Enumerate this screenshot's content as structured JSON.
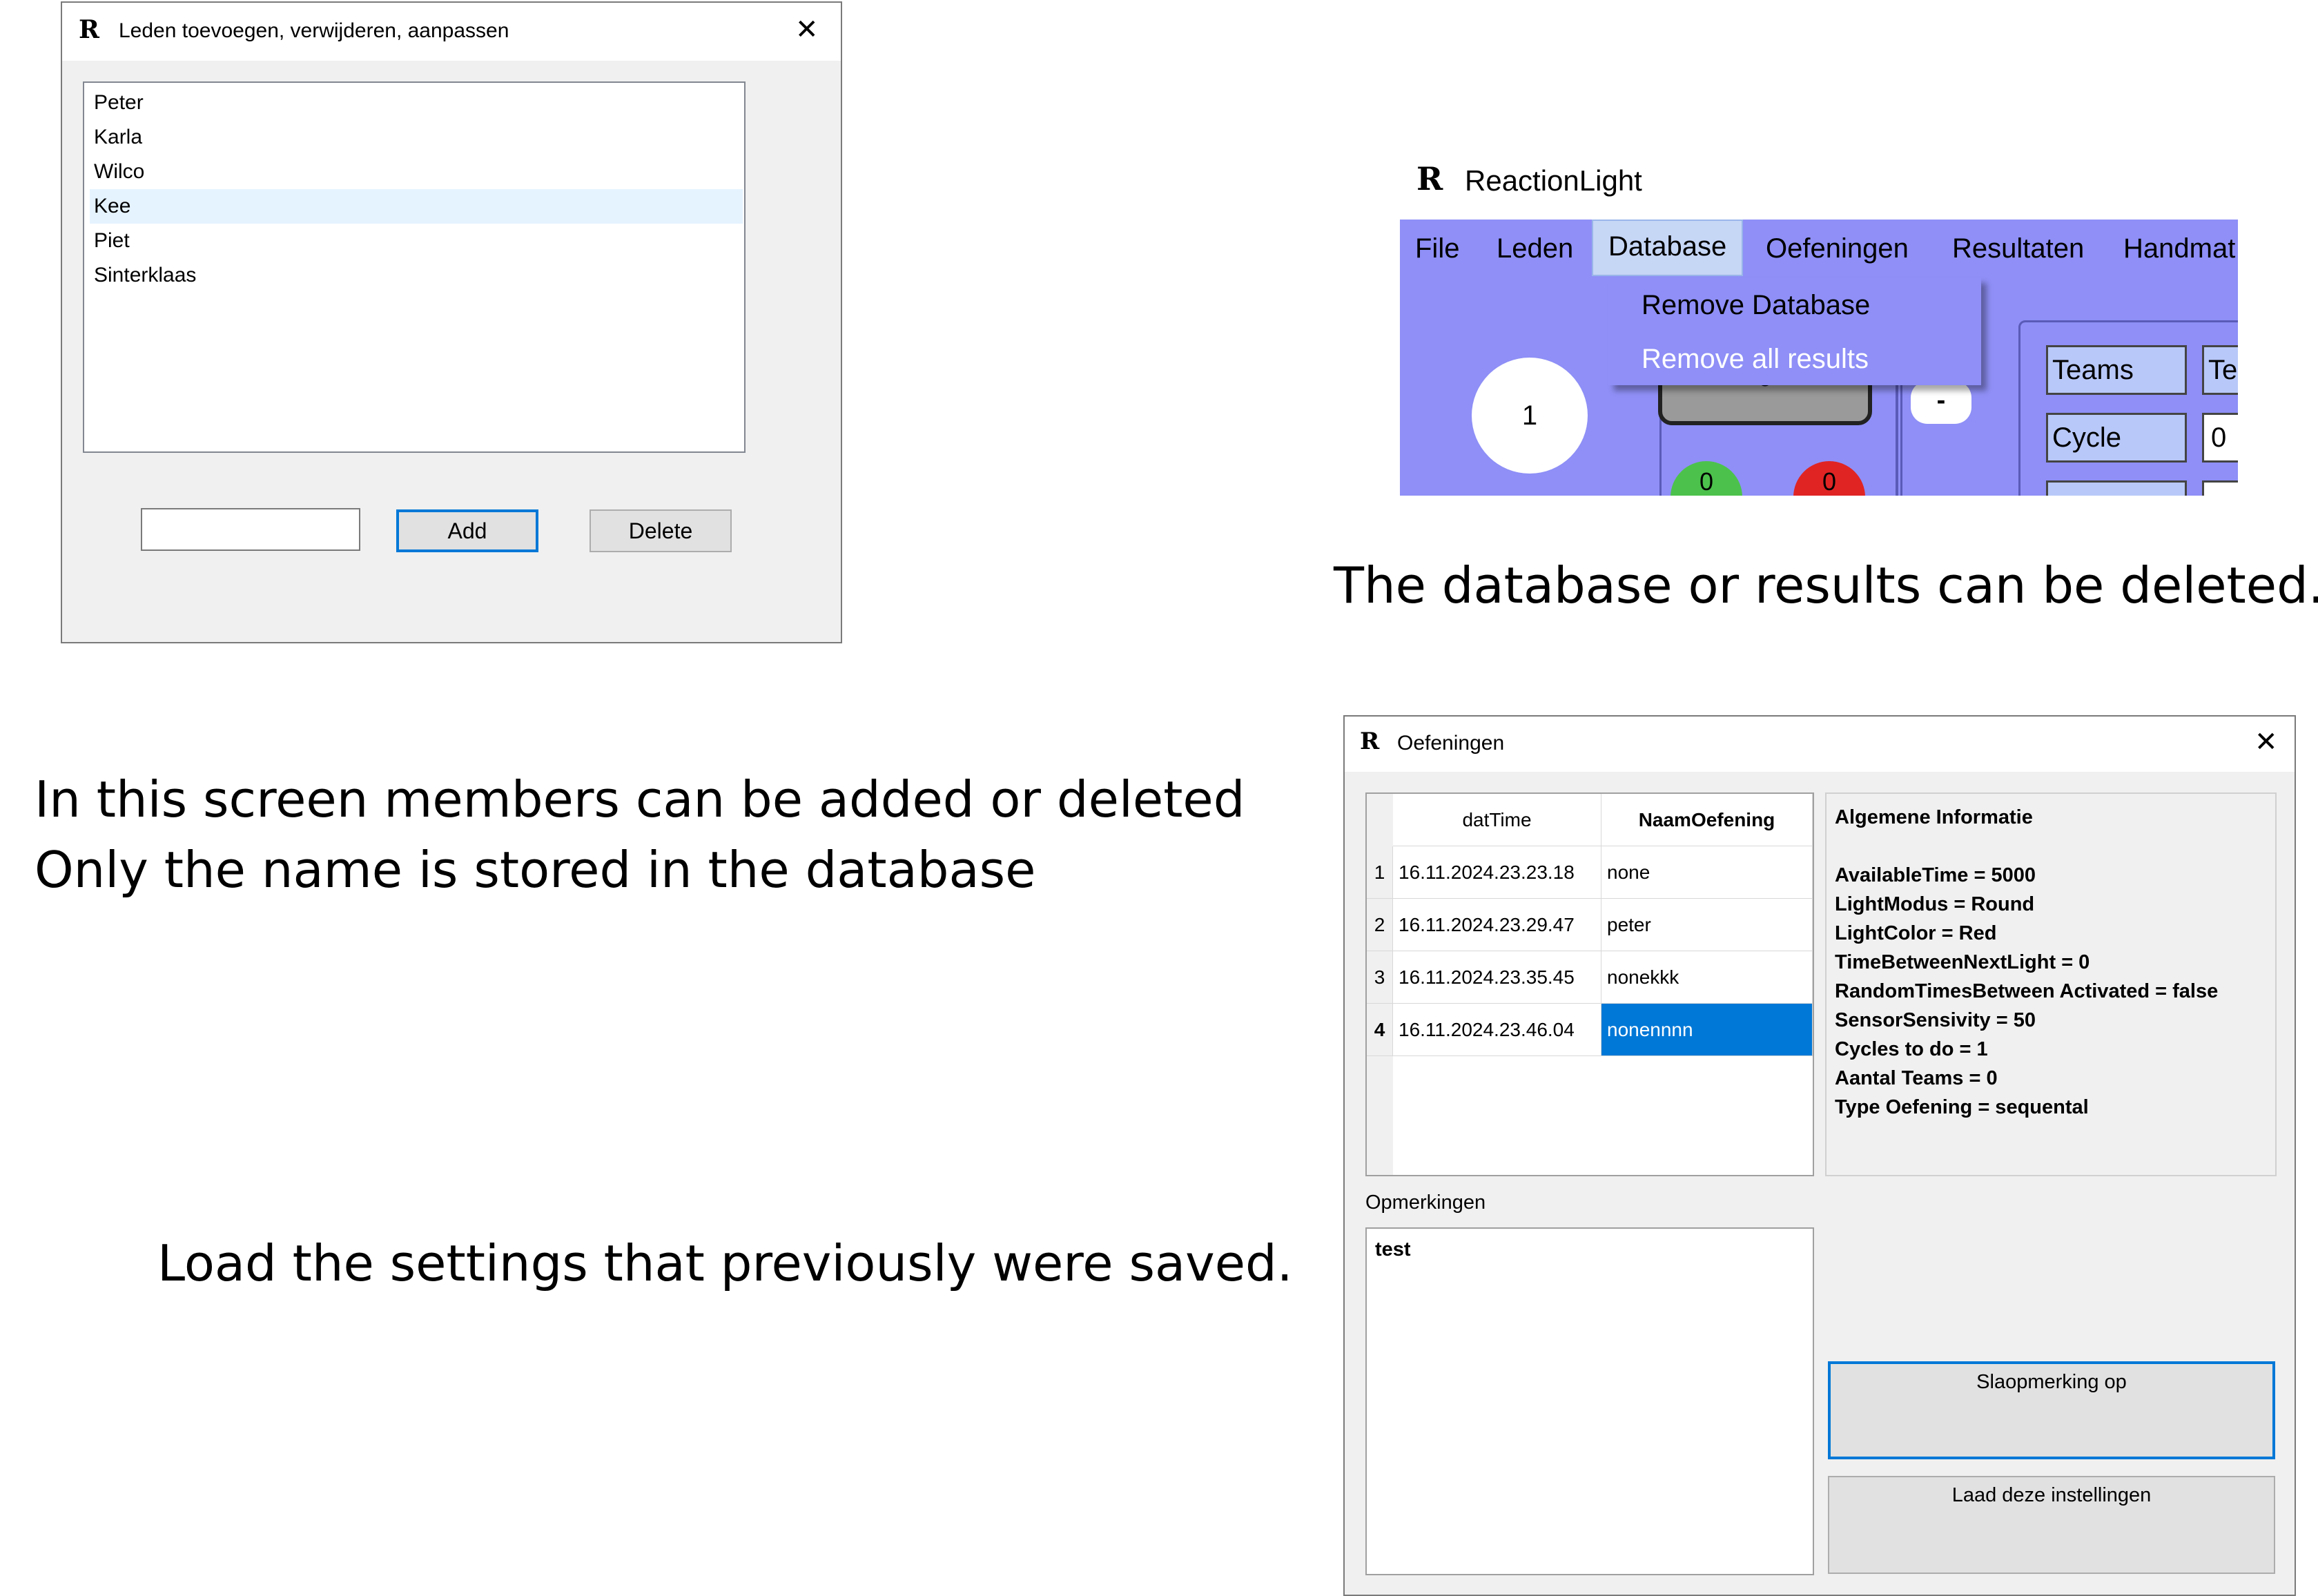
{
  "members_window": {
    "title": "Leden toevoegen, verwijderen, aanpassen",
    "icon_glyph": "R",
    "close_glyph": "✕",
    "members": [
      "Peter",
      "Karla",
      "Wilco",
      "Kee",
      "Piet",
      "Sinterklaas"
    ],
    "selected_index": 3,
    "name_input_value": "",
    "add_label": "Add",
    "delete_label": "Delete"
  },
  "reactionlight": {
    "title": "ReactionLight",
    "icon_glyph": "R",
    "menu": [
      "File",
      "Leden",
      "Database",
      "Oefeningen",
      "Resultaten",
      "Handmat"
    ],
    "active_menu": "Database",
    "dropdown": [
      "Remove Database",
      "Remove all results"
    ],
    "circle_value": "1",
    "counter_value": "0",
    "minus_label": "-",
    "green_value": "0",
    "red_value": "0",
    "teams_label": "Teams",
    "teams_value": "Te",
    "cycle_label": "Cycle",
    "cycle_value": "0",
    "background_color": "#8f8ff7"
  },
  "oefeningen_window": {
    "title": "Oefeningen",
    "icon_glyph": "R",
    "close_glyph": "✕",
    "columns": [
      "datTime",
      "NaamOefening"
    ],
    "rows": [
      {
        "num": "1",
        "datTime": "16.11.2024.23.23.18",
        "naam": "none"
      },
      {
        "num": "2",
        "datTime": "16.11.2024.23.29.47",
        "naam": "peter"
      },
      {
        "num": "3",
        "datTime": "16.11.2024.23.35.45",
        "naam": "nonekkk"
      },
      {
        "num": "4",
        "datTime": "16.11.2024.23.46.04",
        "naam": "nonennnn"
      }
    ],
    "selected_row": 3,
    "info_title": "Algemene Informatie",
    "info_lines": [
      "AvailableTime = 5000",
      "LightModus = Round",
      "LightColor = Red",
      "TimeBetweenNextLight = 0",
      "RandomTimesBetween Activated = false",
      "SensorSensivity = 50",
      "Cycles to do = 1",
      "Aantal Teams = 0",
      "Type Oefening = sequental"
    ],
    "remarks_label": "Opmerkingen",
    "remarks_value": "test",
    "save_remark_label": "Slaopmerking op",
    "load_settings_label": "Laad deze instellingen",
    "selection_color": "#0078d7"
  },
  "captions": {
    "database": "The database or results can be deleted.",
    "members_line1": "In this screen members can be added or deleted",
    "members_line2": "Only the name is stored in the database",
    "load": "Load the settings that previously were saved."
  }
}
